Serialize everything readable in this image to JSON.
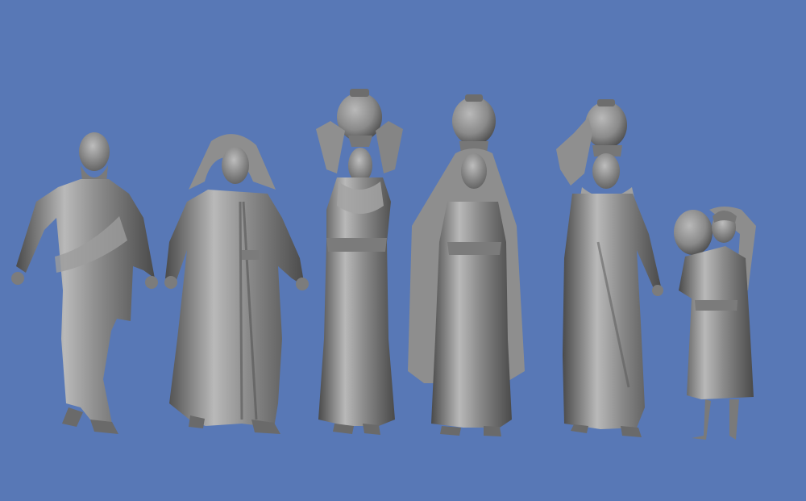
{
  "scene": {
    "background_color": "#5878b6",
    "figure_color": "#8a8a8a",
    "figure_highlight": "#b9b9b9",
    "figure_shadow": "#4a4a4a"
  },
  "figures": [
    {
      "id": "bearded-man",
      "carries_jar": false
    },
    {
      "id": "hooded-man",
      "carries_jar": false
    },
    {
      "id": "woman-jar-arms-up",
      "carries_jar": true
    },
    {
      "id": "veiled-woman-jar",
      "carries_jar": true
    },
    {
      "id": "old-woman-jar",
      "carries_jar": true
    },
    {
      "id": "child-jar-shoulder",
      "carries_jar": true
    }
  ]
}
